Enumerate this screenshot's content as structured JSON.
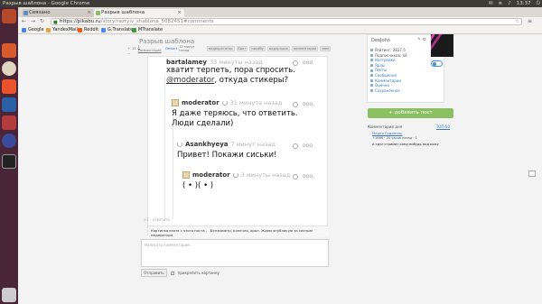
{
  "os": {
    "window_title": "Разрыв шаблона - Google Chrome",
    "clock": "13:37"
  },
  "browser": {
    "tabs": [
      {
        "label": "Связано"
      },
      {
        "label": "Разрыв шаблона"
      }
    ],
    "nav": {
      "back": "←",
      "forward": "→",
      "reload": "↻"
    },
    "address": {
      "host": "https://pikabu.ru",
      "path": "/story/razryiv_shablona_5082451#comments"
    },
    "bookmarks": [
      {
        "label": "Google",
        "color": "#4285f4"
      },
      {
        "label": "YandexMail",
        "color": "#e8a33c"
      },
      {
        "label": "Reddit",
        "color": "#ff5700"
      },
      {
        "label": "G.Translate",
        "color": "#4a8af4"
      },
      {
        "label": "MTranslate",
        "color": "#3c9b3c"
      }
    ]
  },
  "post": {
    "title": "Разрыв шаблона",
    "side_controls": [
      "+",
      "−"
    ],
    "meta": [
      "15",
      "1 Комментарий",
      "Dekiart",
      "12 минут назад",
      "40 секунд назад"
    ],
    "tags": [
      "видеорегатор",
      "брат",
      "пикабу",
      "модерация",
      "комментарии",
      "мем"
    ],
    "below_text": "+1 · ответить"
  },
  "comments": [
    {
      "user": "bartalamey",
      "time": "33 минуты назад",
      "text_before": "хватит терпеть, пора спросить. ",
      "mention": "@moderator",
      "text_after": ", откуда стикеры?"
    },
    {
      "user": "moderator",
      "time": "31 минута назад",
      "text": "Я даже теряюсь, что ответить. Люди сделали)"
    },
    {
      "user": "Asankhyeya",
      "time": "7 минут назад",
      "text": "Привет! Покажи сиськи!"
    },
    {
      "user": "moderator",
      "time": "3 минуты назад",
      "text": "( • )( • )"
    }
  ],
  "comment_controls": {
    "more": "ооо"
  },
  "info_box": "Картинка взята с этого поста - . Бенжаметр, конечно, орал. Ждем опубликую за сисным модератора.",
  "reply": {
    "placeholder": "Написать комментарий",
    "send": "Отправить",
    "attach": "прикрепить картинку"
  },
  "profile": {
    "name": "DeoJohn",
    "items": [
      {
        "label": "Рейтинг: 3827.5",
        "link": false
      },
      {
        "label": "Подписчиков: 44",
        "link": false
      },
      {
        "label": "Настройки",
        "link": true
      },
      {
        "label": "Ярлы",
        "link": true
      },
      {
        "label": "Посты",
        "link": true
      },
      {
        "label": "Сообщения",
        "link": true
      },
      {
        "label": "Комментарии",
        "link": true
      },
      {
        "label": "Оценки",
        "link": true
      },
      {
        "label": "Сохраненное",
        "link": true
      }
    ],
    "add_post": "+ добавить пост"
  },
  "comment_of_day": {
    "title": "Комментарий дня",
    "top": "ТОП-50",
    "user": "Мария Годомаль",
    "score": "+1666  · 20 часов назад · 1",
    "text": "А трул стримит кому-нибудь под кожу"
  }
}
